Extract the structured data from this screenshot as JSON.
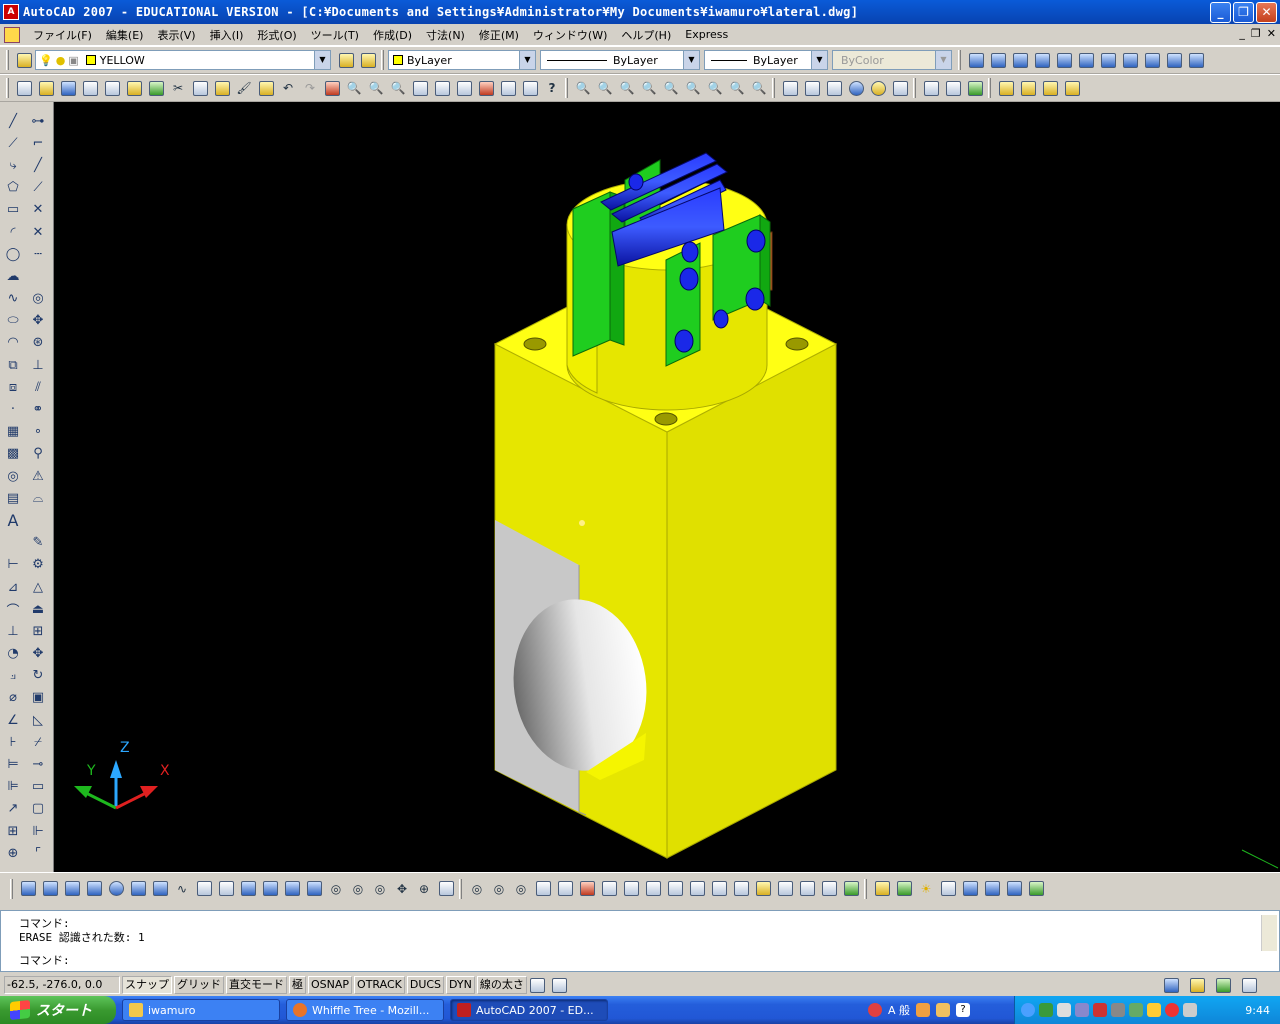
{
  "window": {
    "title": "AutoCAD 2007 - EDUCATIONAL VERSION - [C:¥Documents and Settings¥Administrator¥My Documents¥iwamuro¥lateral.dwg]",
    "app_icon_text": "A",
    "minimize": "_",
    "maximize": "❐",
    "close": "✕"
  },
  "menu": {
    "items": [
      "ファイル(F)",
      "編集(E)",
      "表示(V)",
      "挿入(I)",
      "形式(O)",
      "ツール(T)",
      "作成(D)",
      "寸法(N)",
      "修正(M)",
      "ウィンドウ(W)",
      "ヘルプ(H)",
      "Express"
    ],
    "doc_minimize": "_",
    "doc_restore": "❐",
    "doc_close": "✕"
  },
  "layer": {
    "current": "YELLOW"
  },
  "properties": {
    "color": "ByLayer",
    "linetype": "ByLayer",
    "lineweight": "ByLayer",
    "plotstyle": "ByColor"
  },
  "viewport": {
    "bg_color": "#000000",
    "ucs": {
      "x": "X",
      "y": "Y",
      "z": "Z"
    }
  },
  "command": {
    "lines": [
      "コマンド:",
      "ERASE 認識された数: 1"
    ],
    "prompt": "コマンド:"
  },
  "status": {
    "coords": "-62.5,  -276.0, 0.0",
    "toggles": [
      "スナップ",
      "グリッド",
      "直交モード",
      "極",
      "OSNAP",
      "OTRACK",
      "DUCS",
      "DYN",
      "線の太さ"
    ]
  },
  "taskbar": {
    "start": "スタート",
    "tasks": [
      {
        "label": "iwamuro",
        "icon_color": "#f2c84b"
      },
      {
        "label": "Whiffle Tree - Mozill...",
        "icon_color": "#e8742a"
      },
      {
        "label": "AutoCAD 2007 - ED...",
        "icon_color": "#c02020"
      }
    ],
    "ime": "A 般",
    "clock": "9:44"
  }
}
